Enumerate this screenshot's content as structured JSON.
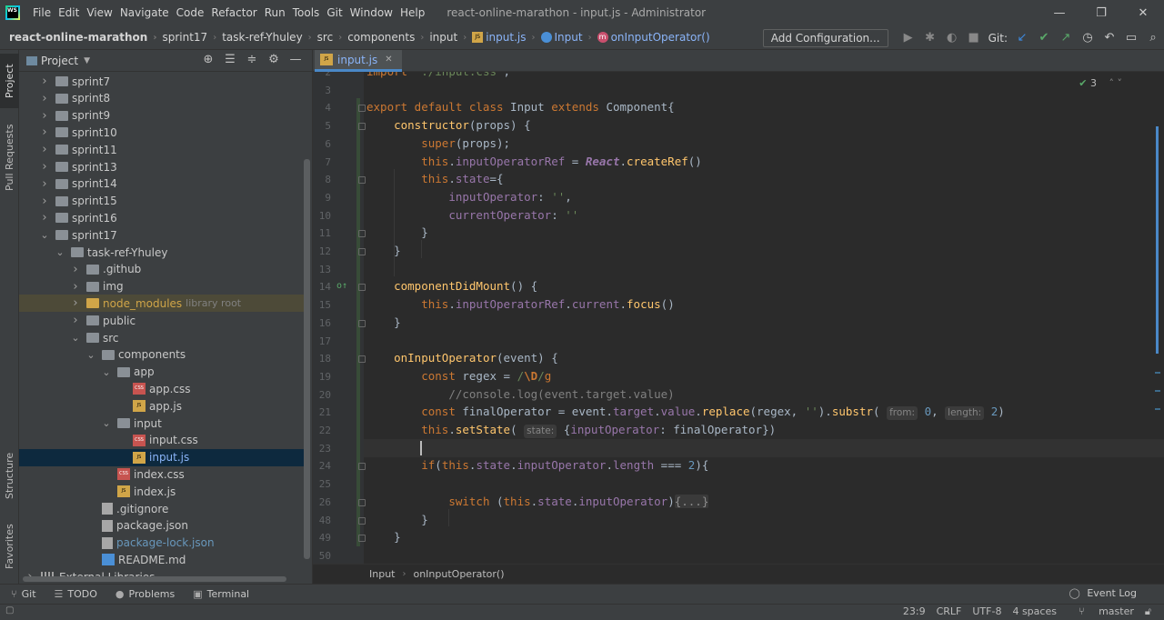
{
  "window": {
    "title": "react-online-marathon - input.js - Administrator",
    "menu": [
      "File",
      "Edit",
      "View",
      "Navigate",
      "Code",
      "Refactor",
      "Run",
      "Tools",
      "Git",
      "Window",
      "Help"
    ]
  },
  "navbar": {
    "crumbs": [
      "react-online-marathon",
      "sprint17",
      "task-ref-Yhuley",
      "src",
      "components",
      "input",
      "input.js",
      "Input",
      "onInputOperator()"
    ],
    "add_configuration": "Add Configuration...",
    "git_label": "Git:"
  },
  "left_strip": {
    "project": "Project",
    "pull_requests": "Pull Requests",
    "structure": "Structure",
    "favorites": "Favorites"
  },
  "project_panel": {
    "title": "Project",
    "tree": [
      {
        "label": "sprint7",
        "type": "folder",
        "depth": 1,
        "expanded": false
      },
      {
        "label": "sprint8",
        "type": "folder",
        "depth": 1,
        "expanded": false
      },
      {
        "label": "sprint9",
        "type": "folder",
        "depth": 1,
        "expanded": false
      },
      {
        "label": "sprint10",
        "type": "folder",
        "depth": 1,
        "expanded": false
      },
      {
        "label": "sprint11",
        "type": "folder",
        "depth": 1,
        "expanded": false
      },
      {
        "label": "sprint13",
        "type": "folder",
        "depth": 1,
        "expanded": false
      },
      {
        "label": "sprint14",
        "type": "folder",
        "depth": 1,
        "expanded": false
      },
      {
        "label": "sprint15",
        "type": "folder",
        "depth": 1,
        "expanded": false
      },
      {
        "label": "sprint16",
        "type": "folder",
        "depth": 1,
        "expanded": false
      },
      {
        "label": "sprint17",
        "type": "folder",
        "depth": 1,
        "expanded": true
      },
      {
        "label": "task-ref-Yhuley",
        "type": "folder",
        "depth": 2,
        "expanded": true
      },
      {
        "label": ".github",
        "type": "folder",
        "depth": 3,
        "expanded": false
      },
      {
        "label": "img",
        "type": "folder",
        "depth": 3,
        "expanded": false
      },
      {
        "label": "node_modules",
        "type": "excluded",
        "depth": 3,
        "expanded": false,
        "note": "library root"
      },
      {
        "label": "public",
        "type": "folder",
        "depth": 3,
        "expanded": false
      },
      {
        "label": "src",
        "type": "folder",
        "depth": 3,
        "expanded": true
      },
      {
        "label": "components",
        "type": "folder",
        "depth": 4,
        "expanded": true
      },
      {
        "label": "app",
        "type": "folder",
        "depth": 5,
        "expanded": true
      },
      {
        "label": "app.css",
        "type": "css",
        "depth": 6
      },
      {
        "label": "app.js",
        "type": "js",
        "depth": 6
      },
      {
        "label": "input",
        "type": "folder",
        "depth": 5,
        "expanded": true
      },
      {
        "label": "input.css",
        "type": "css",
        "depth": 6
      },
      {
        "label": "input.js",
        "type": "js",
        "depth": 6,
        "selected": true
      },
      {
        "label": "index.css",
        "type": "css",
        "depth": 5
      },
      {
        "label": "index.js",
        "type": "js",
        "depth": 5
      },
      {
        "label": ".gitignore",
        "type": "txt",
        "depth": 4
      },
      {
        "label": "package.json",
        "type": "txt",
        "depth": 4
      },
      {
        "label": "package-lock.json",
        "type": "txt",
        "depth": 4,
        "blue": true
      },
      {
        "label": "README.md",
        "type": "md",
        "depth": 4
      },
      {
        "label": "External Libraries",
        "type": "libs",
        "depth": 0,
        "expanded": false
      }
    ]
  },
  "editor": {
    "tab": "input.js",
    "inspections_count": "3",
    "lines": [
      {
        "n": "2",
        "html": "<span class=\"kw\">import</span> <span class=\"str\">'./input.css'</span>;"
      },
      {
        "n": "3",
        "html": ""
      },
      {
        "n": "4",
        "html": "<span class=\"kw\">export default class</span> <span class=\"cls\">Input</span> <span class=\"kw\">extends</span> <span class=\"cls\">Component</span>{"
      },
      {
        "n": "5",
        "html": "    <span class=\"fn\">constructor</span>(props) {"
      },
      {
        "n": "6",
        "html": "        <span class=\"kw\">super</span>(props);"
      },
      {
        "n": "7",
        "html": "        <span class=\"kw\">this</span>.<span class=\"prop\">inputOperatorRef</span> = <span class=\"react\">React</span>.<span class=\"fn\">createRef</span>()"
      },
      {
        "n": "8",
        "html": "        <span class=\"kw\">this</span>.<span class=\"prop\">state</span>={"
      },
      {
        "n": "9",
        "html": "            <span class=\"prop\">inputOperator</span>: <span class=\"str\">''</span>,"
      },
      {
        "n": "10",
        "html": "            <span class=\"prop\">currentOperator</span>: <span class=\"str\">''</span>"
      },
      {
        "n": "11",
        "html": "        }"
      },
      {
        "n": "12",
        "html": "    }"
      },
      {
        "n": "13",
        "html": ""
      },
      {
        "n": "14",
        "html": "    <span class=\"fn\">componentDidMount</span>() {"
      },
      {
        "n": "15",
        "html": "        <span class=\"kw\">this</span>.<span class=\"prop\">inputOperatorRef</span>.<span class=\"prop\">current</span>.<span class=\"fn\">focus</span>()"
      },
      {
        "n": "16",
        "html": "    }"
      },
      {
        "n": "17",
        "html": ""
      },
      {
        "n": "18",
        "html": "    <span class=\"fn\">onInputOperator</span>(event) {"
      },
      {
        "n": "19",
        "html": "        <span class=\"kw\">const</span> regex = <span class=\"str\">/</span><span class=\"regex-b\">\\D</span><span class=\"str\">/</span><span class=\"kw\">g</span>"
      },
      {
        "n": "20",
        "html": "            <span class=\"cmt\">//console.log(event.target.value)</span>"
      },
      {
        "n": "21",
        "html": "        <span class=\"kw\">const</span> finalOperator = event.<span class=\"prop\">target</span>.<span class=\"prop\">value</span>.<span class=\"fn\">replace</span>(regex, <span class=\"str\">''</span>).<span class=\"fn\">substr</span>( <span class=\"hint\">from:</span> <span class=\"num\">0</span>, <span class=\"hint\">length:</span> <span class=\"num\">2</span>)"
      },
      {
        "n": "22",
        "html": "        <span class=\"kw\">this</span>.<span class=\"fn\">setState</span>( <span class=\"hint\">state:</span> {<span class=\"prop\">inputOperator</span>: finalOperator})"
      },
      {
        "n": "23",
        "html": ""
      },
      {
        "n": "24",
        "html": "        <span class=\"kw\">if</span>(<span class=\"kw\">this</span>.<span class=\"prop\">state</span>.<span class=\"prop\">inputOperator</span>.<span class=\"prop\">length</span> === <span class=\"num\">2</span>){"
      },
      {
        "n": "25",
        "html": ""
      },
      {
        "n": "26",
        "html": "            <span class=\"kw\">switch</span> (<span class=\"kw\">this</span>.<span class=\"prop\">state</span>.<span class=\"prop\">inputOperator</span>)<span class=\"folded\">{...}</span>"
      },
      {
        "n": "48",
        "html": "        }"
      },
      {
        "n": "49",
        "html": "    }"
      },
      {
        "n": "50",
        "html": ""
      }
    ],
    "breadcrumbs": [
      "Input",
      "onInputOperator()"
    ]
  },
  "bottom_tools": {
    "git": "Git",
    "todo": "TODO",
    "problems": "Problems",
    "terminal": "Terminal",
    "event_log": "Event Log"
  },
  "status": {
    "position": "23:9",
    "line_sep": "CRLF",
    "encoding": "UTF-8",
    "indent": "4 spaces",
    "branch": "master"
  }
}
